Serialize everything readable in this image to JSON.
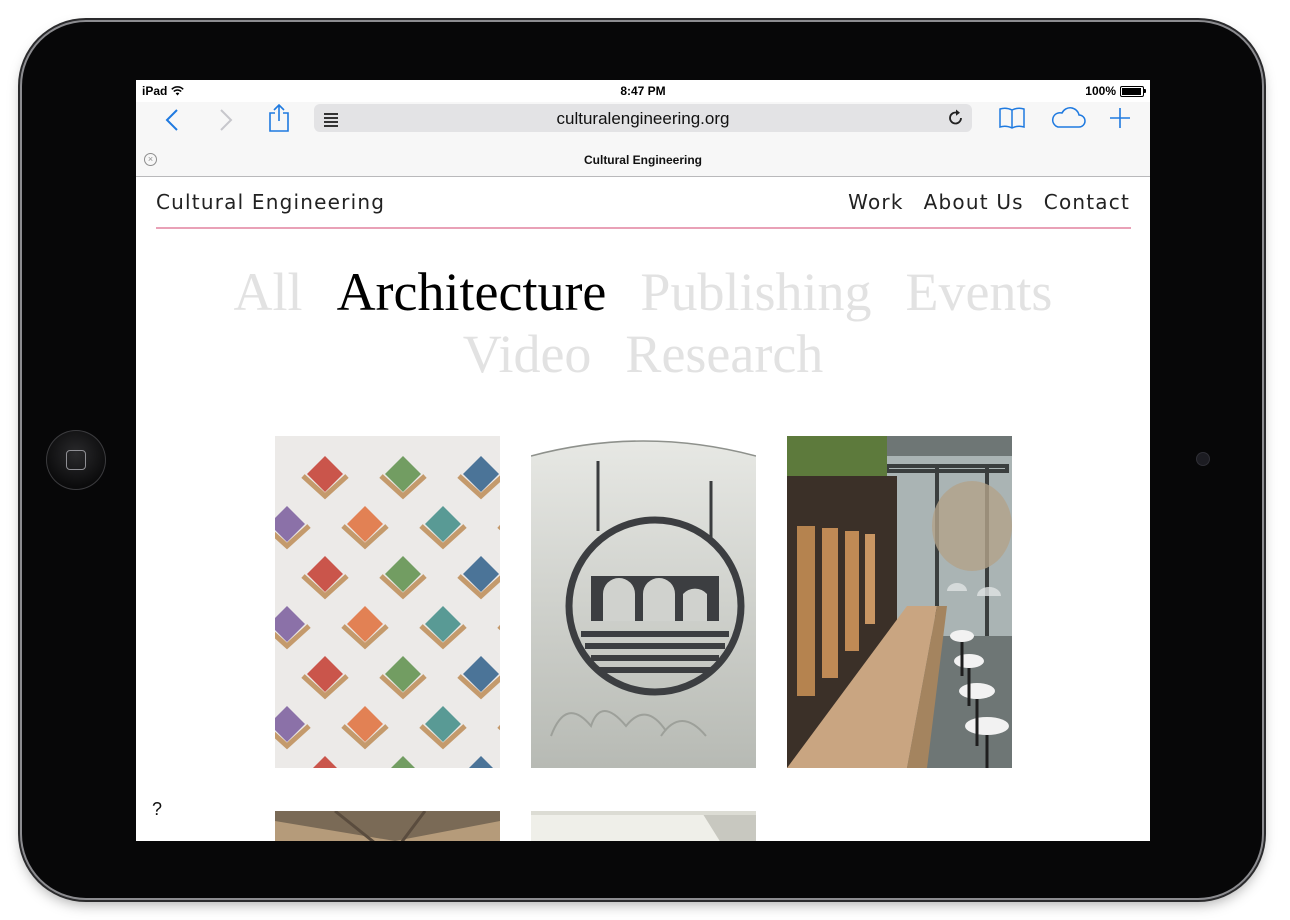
{
  "status": {
    "device": "iPad",
    "time": "8:47 PM",
    "battery": "100%"
  },
  "browser": {
    "url": "culturalengineering.org",
    "tab_title": "Cultural Engineering"
  },
  "site": {
    "title": "Cultural Engineering",
    "nav": [
      "Work",
      "About Us",
      "Contact"
    ]
  },
  "filters": {
    "row1": [
      "All",
      "Architecture",
      "Publishing",
      "Events"
    ],
    "row2": [
      "Video",
      "Research"
    ],
    "active": "Architecture"
  },
  "help_label": "?",
  "colors": {
    "accent_rule": "#e9a1b7",
    "ios_blue": "#1f7ae0",
    "inactive_filter": "#e2e2e2"
  }
}
